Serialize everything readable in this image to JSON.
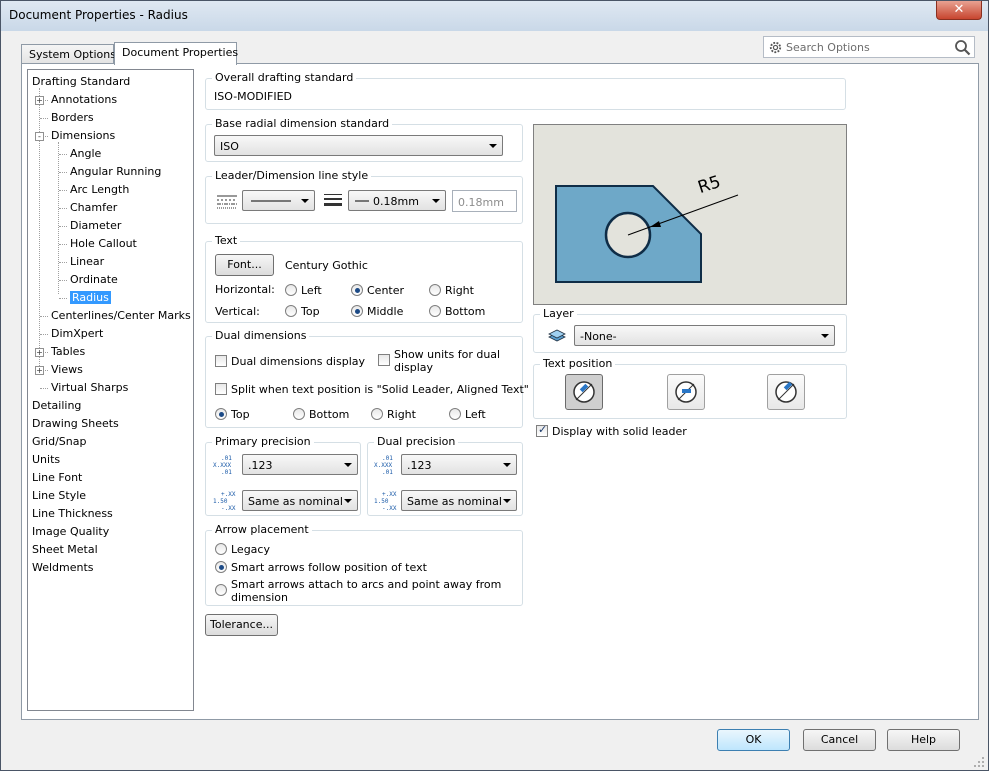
{
  "window": {
    "title": "Document Properties - Radius",
    "close_glyph": "✕"
  },
  "tabs": [
    "System Options",
    "Document Properties"
  ],
  "search": {
    "placeholder": "Search Options"
  },
  "tree": {
    "items": [
      {
        "label": "Drafting Standard",
        "level": 0
      },
      {
        "label": "Annotations",
        "level": 1,
        "expander": "+"
      },
      {
        "label": "Borders",
        "level": 1
      },
      {
        "label": "Dimensions",
        "level": 1,
        "expander": "-"
      },
      {
        "label": "Angle",
        "level": 2
      },
      {
        "label": "Angular Running",
        "level": 2
      },
      {
        "label": "Arc Length",
        "level": 2
      },
      {
        "label": "Chamfer",
        "level": 2
      },
      {
        "label": "Diameter",
        "level": 2
      },
      {
        "label": "Hole Callout",
        "level": 2
      },
      {
        "label": "Linear",
        "level": 2
      },
      {
        "label": "Ordinate",
        "level": 2
      },
      {
        "label": "Radius",
        "level": 2,
        "selected": true
      },
      {
        "label": "Centerlines/Center Marks",
        "level": 1
      },
      {
        "label": "DimXpert",
        "level": 1
      },
      {
        "label": "Tables",
        "level": 1,
        "expander": "+"
      },
      {
        "label": "Views",
        "level": 1,
        "expander": "+"
      },
      {
        "label": "Virtual Sharps",
        "level": 1
      },
      {
        "label": "Detailing",
        "level": 0
      },
      {
        "label": "Drawing Sheets",
        "level": 0
      },
      {
        "label": "Grid/Snap",
        "level": 0
      },
      {
        "label": "Units",
        "level": 0
      },
      {
        "label": "Line Font",
        "level": 0
      },
      {
        "label": "Line Style",
        "level": 0
      },
      {
        "label": "Line Thickness",
        "level": 0
      },
      {
        "label": "Image Quality",
        "level": 0
      },
      {
        "label": "Sheet Metal",
        "level": 0
      },
      {
        "label": "Weldments",
        "level": 0
      }
    ]
  },
  "overall": {
    "label": "Overall drafting standard",
    "value": "ISO-MODIFIED"
  },
  "base_radial": {
    "label": "Base radial dimension standard",
    "value": "ISO"
  },
  "leader_style": {
    "label": "Leader/Dimension line style",
    "thickness": "0.18mm",
    "custom": "0.18mm"
  },
  "text": {
    "label": "Text",
    "font_button": "Font...",
    "font_name": "Century Gothic",
    "horizontal_label": "Horizontal:",
    "h_options": [
      "Left",
      "Center",
      "Right"
    ],
    "h_selected": "Center",
    "vertical_label": "Vertical:",
    "v_options": [
      "Top",
      "Middle",
      "Bottom"
    ],
    "v_selected": "Middle"
  },
  "dual": {
    "label": "Dual dimensions",
    "display": "Dual dimensions display",
    "show_units": "Show units for dual display",
    "split": "Split when text position is \"Solid Leader, Aligned Text\"",
    "positions": [
      "Top",
      "Bottom",
      "Right",
      "Left"
    ],
    "position_selected": "Top"
  },
  "primary_precision": {
    "label": "Primary precision",
    "value": ".123",
    "tolerance": "Same as nominal"
  },
  "dual_precision": {
    "label": "Dual precision",
    "value": ".123",
    "tolerance": "Same as nominal"
  },
  "precision_icons": {
    "value_top": ".01",
    "value_mid": "X.XXX",
    "value_bot": ".01",
    "tol_top": "+.XX",
    "tol_mid": "1.50",
    "tol_bot": "-.XX"
  },
  "arrow_placement": {
    "label": "Arrow placement",
    "options": [
      "Legacy",
      "Smart arrows follow position of text",
      "Smart arrows attach to arcs and point away from dimension"
    ],
    "selected": 1
  },
  "tolerance_button": "Tolerance...",
  "preview": {
    "dimension_text": "R5",
    "fill": "#6ea8c8"
  },
  "layer": {
    "label": "Layer",
    "value": "-None-"
  },
  "text_position": {
    "label": "Text position",
    "selected": 0
  },
  "solid_leader": {
    "label": "Display with solid leader",
    "checked": true
  },
  "footer": {
    "ok": "OK",
    "cancel": "Cancel",
    "help": "Help"
  }
}
